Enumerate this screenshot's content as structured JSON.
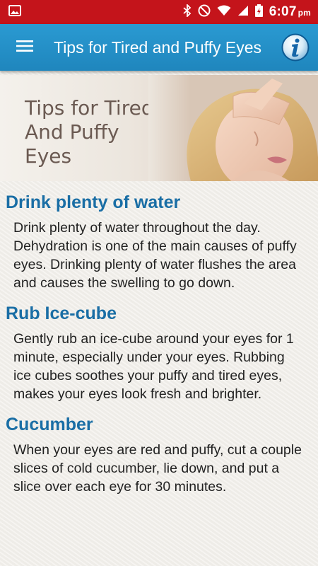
{
  "status_bar": {
    "time": "6:07",
    "ampm": "pm",
    "icons": [
      "image-icon",
      "bluetooth-icon",
      "do-not-disturb-icon",
      "wifi-icon",
      "signal-icon",
      "battery-icon"
    ]
  },
  "app_bar": {
    "title": "Tips for Tired and Puffy Eyes",
    "menu_icon": "hamburger-menu-icon",
    "info_icon": "info-icon",
    "color": "#2290c9"
  },
  "hero": {
    "line1": "Tips for Tired",
    "line2": "And Puffy",
    "line3": "Eyes"
  },
  "sections": [
    {
      "title": "Drink plenty of water",
      "body": "Drink plenty of water throughout the day. Dehydration is one of the main causes of puffy eyes. Drinking plenty of water flushes the area and causes the swelling to go down."
    },
    {
      "title": "Rub Ice-cube",
      "body": "Gently rub an ice-cube around your eyes for 1 minute, especially under your eyes. Rubbing ice cubes soothes your puffy and tired eyes, makes your eyes look fresh and brighter."
    },
    {
      "title": "Cucumber",
      "body": "When your eyes are red and puffy, cut a couple slices of cold cucumber, lie down, and put a slice over each eye for 30 minutes."
    }
  ],
  "colors": {
    "status_bar": "#c4141b",
    "heading": "#1a6ea5"
  }
}
